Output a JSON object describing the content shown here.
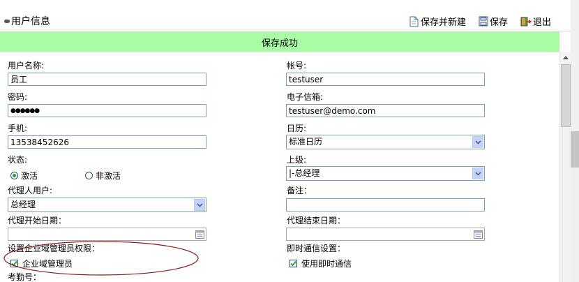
{
  "header": {
    "title": "用户信息"
  },
  "toolbar": {
    "save_new": "保存并新建",
    "save": "保存",
    "exit": "退出"
  },
  "banner": {
    "message": "保存成功"
  },
  "form": {
    "username": {
      "label": "用户名称:",
      "value": "员工"
    },
    "account": {
      "label": "帐号:",
      "value": "testuser"
    },
    "password": {
      "label": "密码:",
      "value": "●●●●●●"
    },
    "email": {
      "label": "电子信箱:",
      "value": "testuser@demo.com"
    },
    "mobile": {
      "label": "手机:",
      "value": "13538452626"
    },
    "calendar": {
      "label": "日历:",
      "value": "标准日历"
    },
    "status": {
      "label": "状态:",
      "options": [
        "激活",
        "非激活"
      ],
      "selected": "激活"
    },
    "superior": {
      "label": "上级:",
      "value": "|-总经理"
    },
    "proxy_user": {
      "label": "代理人用户:",
      "value": "总经理"
    },
    "remark": {
      "label": "备注：",
      "value": ""
    },
    "proxy_start": {
      "label": "代理开始日期：",
      "value": ""
    },
    "proxy_end": {
      "label": "代理结束日期：",
      "value": ""
    },
    "domain_admin": {
      "label": "设置企业域管理员权限：",
      "checkbox_label": "企业域管理员",
      "checked": true
    },
    "im": {
      "label": "即时通信设置：",
      "checkbox_label": "使用即时通信",
      "checked": true
    },
    "attendance": {
      "label": "考勤号："
    }
  },
  "colors": {
    "banner": "#a9fda4",
    "annotation": "#8b1a1a",
    "input_border": "#7f9db9"
  }
}
